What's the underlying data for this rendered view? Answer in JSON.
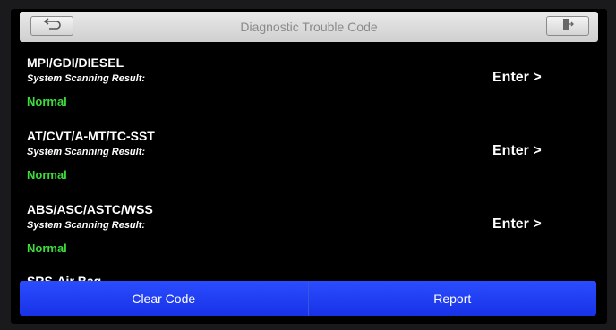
{
  "header": {
    "title": "Diagnostic Trouble Code",
    "back_icon": "back-arrow-icon",
    "exit_icon": "exit-door-icon"
  },
  "systems": [
    {
      "name": "MPI/GDI/DIESEL",
      "subtitle": "System Scanning Result:",
      "status": "Normal",
      "action": "Enter >"
    },
    {
      "name": "AT/CVT/A-MT/TC-SST",
      "subtitle": "System Scanning Result:",
      "status": "Normal",
      "action": "Enter >"
    },
    {
      "name": "ABS/ASC/ASTC/WSS",
      "subtitle": "System Scanning Result:",
      "status": "Normal",
      "action": "Enter >"
    },
    {
      "name": "SRS-Air Bag",
      "subtitle": "",
      "status": "",
      "action": ""
    }
  ],
  "footer": {
    "clear_label": "Clear Code",
    "report_label": "Report"
  },
  "colors": {
    "status_normal": "#3ddc3d",
    "button_blue": "#1f3cff"
  }
}
